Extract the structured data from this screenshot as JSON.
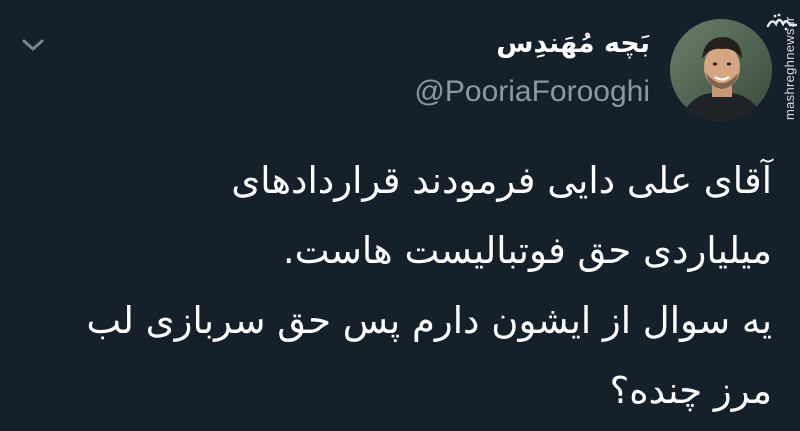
{
  "tweet": {
    "display_name": "بَچه مُهَندِس",
    "handle": "@PooriaForooghi",
    "lines": [
      "آقای علی دایی فرمودند قراردادهای",
      "میلیاردی حق فوتبالیست هاست.",
      "یه سوال از ایشون دارم پس حق سربازی لب",
      "مرز چنده؟"
    ]
  },
  "watermark": {
    "logo_text": "مشرق",
    "url": "mashreghnews.ir"
  },
  "icons": {
    "menu": "chevron-down-icon",
    "avatar": "profile-photo"
  },
  "colors": {
    "background": "#15202b",
    "text": "#ffffff",
    "secondary_text": "#8899a6",
    "chevron": "#7a8590"
  }
}
